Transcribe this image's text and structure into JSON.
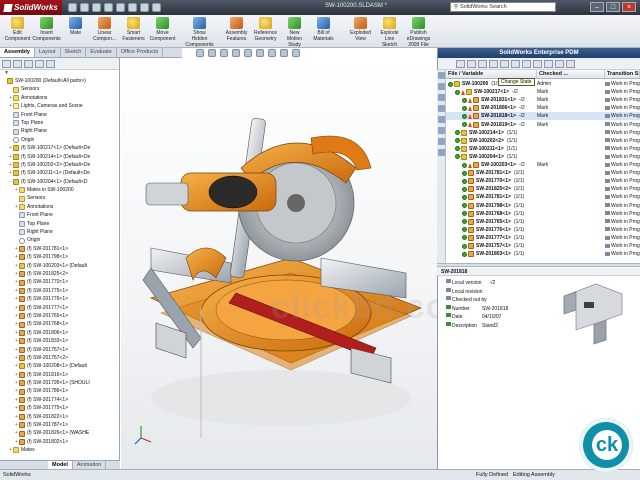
{
  "app": {
    "logo_text": "SolidWorks",
    "window_title": "SW-100200.SLDASM *",
    "search_placeholder": "SolidWorks Search"
  },
  "ribbon": [
    {
      "label": "Edit\nComponent",
      "icon": "edit-component-icon"
    },
    {
      "label": "Insert\nComponents",
      "icon": "insert-components-icon"
    },
    {
      "label": "Mate",
      "icon": "mate-icon"
    },
    {
      "label": "Linear\nCompon...",
      "icon": "linear-pattern-icon"
    },
    {
      "label": "Smart\nFasteners",
      "icon": "smart-fasteners-icon"
    },
    {
      "label": "Move\nComponent",
      "icon": "move-component-icon"
    },
    {
      "label": "Show\nHidden\nComponents",
      "icon": "show-hidden-icon"
    },
    {
      "label": "Assembly\nFeatures",
      "icon": "assembly-features-icon"
    },
    {
      "label": "Reference\nGeometry",
      "icon": "reference-geometry-icon"
    },
    {
      "label": "New\nMotion\nStudy",
      "icon": "motion-study-icon"
    },
    {
      "label": "Bill of\nMaterials",
      "icon": "bom-icon"
    },
    {
      "label": "Exploded\nView",
      "icon": "exploded-view-icon"
    },
    {
      "label": "Explode\nLine\nSketch",
      "icon": "explode-line-icon"
    },
    {
      "label": "Publish\neDrawings\n2009 File",
      "icon": "publish-edrawings-icon"
    }
  ],
  "command_tabs": [
    "Assembly",
    "Layout",
    "Sketch",
    "Evaluate",
    "Office Products"
  ],
  "feature_tree": {
    "filter_icon": "filter-icon",
    "rows": [
      {
        "text": "SW-100200 (Default<All parts>)",
        "icon": "asm",
        "indent": 0,
        "exp": ""
      },
      {
        "text": "Sensors",
        "icon": "fld",
        "indent": 1,
        "exp": ""
      },
      {
        "text": "Annotations",
        "icon": "fld",
        "indent": 1,
        "exp": "+"
      },
      {
        "text": "Lights, Cameras and Scene",
        "icon": "lgt",
        "indent": 1,
        "exp": "+"
      },
      {
        "text": "Front Plane",
        "icon": "pln",
        "indent": 1,
        "exp": ""
      },
      {
        "text": "Top Plane",
        "icon": "pln",
        "indent": 1,
        "exp": ""
      },
      {
        "text": "Right Plane",
        "icon": "pln",
        "indent": 1,
        "exp": ""
      },
      {
        "text": "Origin",
        "icon": "org",
        "indent": 1,
        "exp": ""
      },
      {
        "text": "(f) SW-100217<1> (Default<De",
        "icon": "asm",
        "indent": 1,
        "exp": "+"
      },
      {
        "text": "(f) SW-100214<1> (Default<De",
        "icon": "asm",
        "indent": 1,
        "exp": "+"
      },
      {
        "text": "(f) SW-100202<2> (Default<De",
        "icon": "asm",
        "indent": 1,
        "exp": "+"
      },
      {
        "text": "(f) SW-100211<1> (Default<De",
        "icon": "asm",
        "indent": 1,
        "exp": "+"
      },
      {
        "text": "(f) SW-100204<1> (Default<D",
        "icon": "asm",
        "indent": 1,
        "exp": "-"
      },
      {
        "text": "Mates in SW-100200",
        "icon": "fld",
        "indent": 2,
        "exp": "+"
      },
      {
        "text": "Sensors",
        "icon": "fld",
        "indent": 2,
        "exp": ""
      },
      {
        "text": "Annotations",
        "icon": "fld",
        "indent": 2,
        "exp": "+"
      },
      {
        "text": "Front Plane",
        "icon": "pln",
        "indent": 2,
        "exp": ""
      },
      {
        "text": "Top Plane",
        "icon": "pln",
        "indent": 2,
        "exp": ""
      },
      {
        "text": "Right Plane",
        "icon": "pln",
        "indent": 2,
        "exp": ""
      },
      {
        "text": "Origin",
        "icon": "org",
        "indent": 2,
        "exp": ""
      },
      {
        "text": "(f) SW-201781<1>",
        "icon": "prt",
        "indent": 2,
        "exp": "+"
      },
      {
        "text": "(f) SW-201798<1>",
        "icon": "prt",
        "indent": 2,
        "exp": "+"
      },
      {
        "text": "(f) SW-100203<1> (Default",
        "icon": "asm",
        "indent": 2,
        "exp": "+"
      },
      {
        "text": "(f) SW-201825<2>",
        "icon": "prt",
        "indent": 2,
        "exp": "+"
      },
      {
        "text": "(f) SW-201770<1>",
        "icon": "prt",
        "indent": 2,
        "exp": "+"
      },
      {
        "text": "(f) SW-201775<1>",
        "icon": "prt",
        "indent": 2,
        "exp": "+"
      },
      {
        "text": "(f) SW-201776<1>",
        "icon": "prt",
        "indent": 2,
        "exp": "+"
      },
      {
        "text": "(f) SW-201777<1>",
        "icon": "prt",
        "indent": 2,
        "exp": "+"
      },
      {
        "text": "(f) SW-201765<1>",
        "icon": "prt",
        "indent": 2,
        "exp": "+"
      },
      {
        "text": "(f) SW-201768<1>",
        "icon": "prt",
        "indent": 2,
        "exp": "+"
      },
      {
        "text": "(f) SW-201806<1>",
        "icon": "prt",
        "indent": 2,
        "exp": "+"
      },
      {
        "text": "(f) SW-201833<1>",
        "icon": "prt",
        "indent": 2,
        "exp": "+"
      },
      {
        "text": "(f) SW-201757<1>",
        "icon": "prt",
        "indent": 2,
        "exp": "+"
      },
      {
        "text": "(f) SW-201757<2>",
        "icon": "prt",
        "indent": 2,
        "exp": "+"
      },
      {
        "text": "(f) SW-100208<1> (Default",
        "icon": "asm",
        "indent": 2,
        "exp": "+"
      },
      {
        "text": "(f) SW-201816<1>",
        "icon": "prt",
        "indent": 2,
        "exp": "+"
      },
      {
        "text": "(f) SW-201795<1> (SHOULI",
        "icon": "prt",
        "indent": 2,
        "exp": "+"
      },
      {
        "text": "(f) SW-201786<1>",
        "icon": "prt",
        "indent": 2,
        "exp": "+"
      },
      {
        "text": "(f) SW-201774<1>",
        "icon": "prt",
        "indent": 2,
        "exp": "+"
      },
      {
        "text": "(f) SW-201775<1>",
        "icon": "prt",
        "indent": 2,
        "exp": "+"
      },
      {
        "text": "(f) SW-201822<1>",
        "icon": "prt",
        "indent": 2,
        "exp": "+"
      },
      {
        "text": "(f) SW-201787<1>",
        "icon": "prt",
        "indent": 2,
        "exp": "+"
      },
      {
        "text": "(f) SW-201826<1> (WASHE",
        "icon": "prt",
        "indent": 2,
        "exp": "+"
      },
      {
        "text": "(f) SW-201802<1>",
        "icon": "prt",
        "indent": 2,
        "exp": "+"
      },
      {
        "text": "Mates",
        "icon": "fld",
        "indent": 1,
        "exp": "+"
      }
    ]
  },
  "tree_tabs": [
    "Model",
    "Animation"
  ],
  "pdm": {
    "title": "SolidWorks Enterprise PDM",
    "tooltip": "Change State",
    "columns": [
      "File / Variable",
      "Checked ...",
      "Transition St"
    ],
    "rows": [
      {
        "ind": 0,
        "state": "g",
        "warn": false,
        "name": "SW-100200",
        "ver": "(1/1)",
        "who": "Admin",
        "status": "Work in Prog",
        "sel": false,
        "bold": true
      },
      {
        "ind": 1,
        "state": "g",
        "warn": true,
        "name": "SW-100217<1>",
        "ver": "-/2",
        "who": "Mark",
        "status": "Work in Prog",
        "sel": false,
        "bold": true
      },
      {
        "ind": 2,
        "state": "g",
        "warn": true,
        "name": "SW-201831<1>",
        "ver": "-/2",
        "who": "Mark",
        "status": "Work in Prog",
        "sel": false,
        "bold": true
      },
      {
        "ind": 2,
        "state": "g",
        "warn": true,
        "name": "SW-201806<1>",
        "ver": "-/2",
        "who": "Mark",
        "status": "Work in Prog",
        "sel": false,
        "bold": true
      },
      {
        "ind": 2,
        "state": "g",
        "warn": true,
        "name": "SW-201818<1>",
        "ver": "-/2",
        "who": "Mark",
        "status": "Work in Prog",
        "sel": true,
        "bold": true
      },
      {
        "ind": 2,
        "state": "g",
        "warn": true,
        "name": "SW-201819<1>",
        "ver": "-/2",
        "who": "Mark",
        "status": "Work in Prog",
        "sel": false,
        "bold": true
      },
      {
        "ind": 1,
        "state": "g",
        "warn": false,
        "name": "SW-100214<1>",
        "ver": "(1/1)",
        "who": "",
        "status": "Work in Prog",
        "sel": false,
        "bold": true
      },
      {
        "ind": 1,
        "state": "g",
        "warn": false,
        "name": "SW-100202<2>",
        "ver": "(1/1)",
        "who": "",
        "status": "Work in Prog",
        "sel": false,
        "bold": true
      },
      {
        "ind": 1,
        "state": "g",
        "warn": false,
        "name": "SW-100211<1>",
        "ver": "(1/1)",
        "who": "",
        "status": "Work in Prog",
        "sel": false,
        "bold": true
      },
      {
        "ind": 1,
        "state": "g",
        "warn": false,
        "name": "SW-100204<1>",
        "ver": "(1/1)",
        "who": "",
        "status": "Work in Prog",
        "sel": false,
        "bold": true
      },
      {
        "ind": 2,
        "state": "g",
        "warn": true,
        "name": "SW-100203<1>",
        "ver": "-/2",
        "who": "Mark",
        "status": "Work in Prog",
        "sel": false,
        "bold": true
      },
      {
        "ind": 2,
        "state": "g",
        "warn": false,
        "name": "SW-201781<1>",
        "ver": "(1/1)",
        "who": "",
        "status": "Work in Prog",
        "sel": false,
        "bold": true
      },
      {
        "ind": 2,
        "state": "g",
        "warn": false,
        "name": "SW-201770<1>",
        "ver": "(1/1)",
        "who": "",
        "status": "Work in Prog",
        "sel": false,
        "bold": true
      },
      {
        "ind": 2,
        "state": "g",
        "warn": false,
        "name": "SW-201825<2>",
        "ver": "(1/1)",
        "who": "",
        "status": "Work in Prog",
        "sel": false,
        "bold": true
      },
      {
        "ind": 2,
        "state": "g",
        "warn": false,
        "name": "SW-201781<1>",
        "ver": "(1/1)",
        "who": "",
        "status": "Work in Prog",
        "sel": false,
        "bold": true
      },
      {
        "ind": 2,
        "state": "g",
        "warn": false,
        "name": "SW-201798<1>",
        "ver": "(1/1)",
        "who": "",
        "status": "Work in Prog",
        "sel": false,
        "bold": true
      },
      {
        "ind": 2,
        "state": "g",
        "warn": false,
        "name": "SW-201768<1>",
        "ver": "(1/1)",
        "who": "",
        "status": "Work in Prog",
        "sel": false,
        "bold": true
      },
      {
        "ind": 2,
        "state": "g",
        "warn": false,
        "name": "SW-201765<1>",
        "ver": "(1/1)",
        "who": "",
        "status": "Work in Prog",
        "sel": false,
        "bold": true
      },
      {
        "ind": 2,
        "state": "g",
        "warn": false,
        "name": "SW-201776<1>",
        "ver": "(1/1)",
        "who": "",
        "status": "Work in Prog",
        "sel": false,
        "bold": true
      },
      {
        "ind": 2,
        "state": "g",
        "warn": false,
        "name": "SW-201777<1>",
        "ver": "(1/1)",
        "who": "",
        "status": "Work in Prog",
        "sel": false,
        "bold": true
      },
      {
        "ind": 2,
        "state": "g",
        "warn": false,
        "name": "SW-201757<1>",
        "ver": "(1/1)",
        "who": "",
        "status": "Work in Prog",
        "sel": false,
        "bold": true
      },
      {
        "ind": 2,
        "state": "g",
        "warn": false,
        "name": "SW-201803<1>",
        "ver": "(1/1)",
        "who": "",
        "status": "Work in Prog",
        "sel": false,
        "bold": true
      }
    ],
    "detail_tab": "SW-201818",
    "details": [
      {
        "key": "",
        "value": "Local version",
        "extra": "-/2"
      },
      {
        "key": "",
        "value": "Local revision",
        "extra": ""
      },
      {
        "key": "",
        "value": "Checked out by",
        "extra": ""
      },
      {
        "key": "Number",
        "value": "SW-201818",
        "extra": ""
      },
      {
        "key": "Date",
        "value": "04/10/07",
        "extra": ""
      },
      {
        "key": "Description",
        "value": "Stand2",
        "extra": ""
      }
    ]
  },
  "statusbar": {
    "left": "SolidWorks",
    "state": "Fully Defined",
    "mode": "Editing Assembly"
  },
  "badge": "ck",
  "watermark": "clickbd.com"
}
